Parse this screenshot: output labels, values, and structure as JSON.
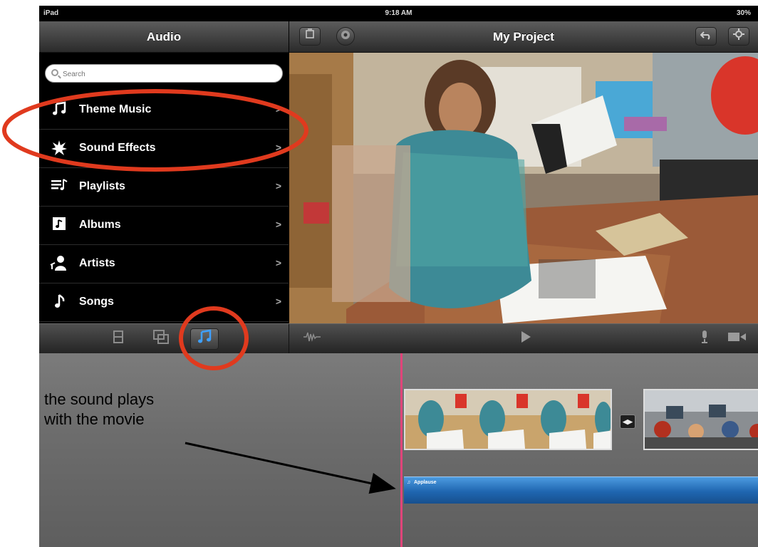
{
  "status_bar": {
    "device": "iPad",
    "time": "9:18 AM",
    "battery": "30%"
  },
  "audio_panel": {
    "title": "Audio",
    "search": {
      "placeholder": "Search",
      "value": ""
    },
    "items": [
      {
        "label": "Theme Music",
        "icon": "music-note-icon"
      },
      {
        "label": "Sound Effects",
        "icon": "starburst-icon"
      },
      {
        "label": "Playlists",
        "icon": "playlist-icon"
      },
      {
        "label": "Albums",
        "icon": "album-icon"
      },
      {
        "label": "Artists",
        "icon": "artist-icon"
      },
      {
        "label": "Songs",
        "icon": "single-note-icon"
      }
    ]
  },
  "project": {
    "title": "My Project"
  },
  "timeline": {
    "audio_clip_label": "Applause"
  },
  "annotation": {
    "line1": "the sound plays",
    "line2": "with the movie"
  },
  "colors": {
    "highlight": "#e03a1e",
    "playhead": "#e0457a",
    "audio_track": "#1f66b0",
    "active_tab": "#3ea0ff"
  }
}
